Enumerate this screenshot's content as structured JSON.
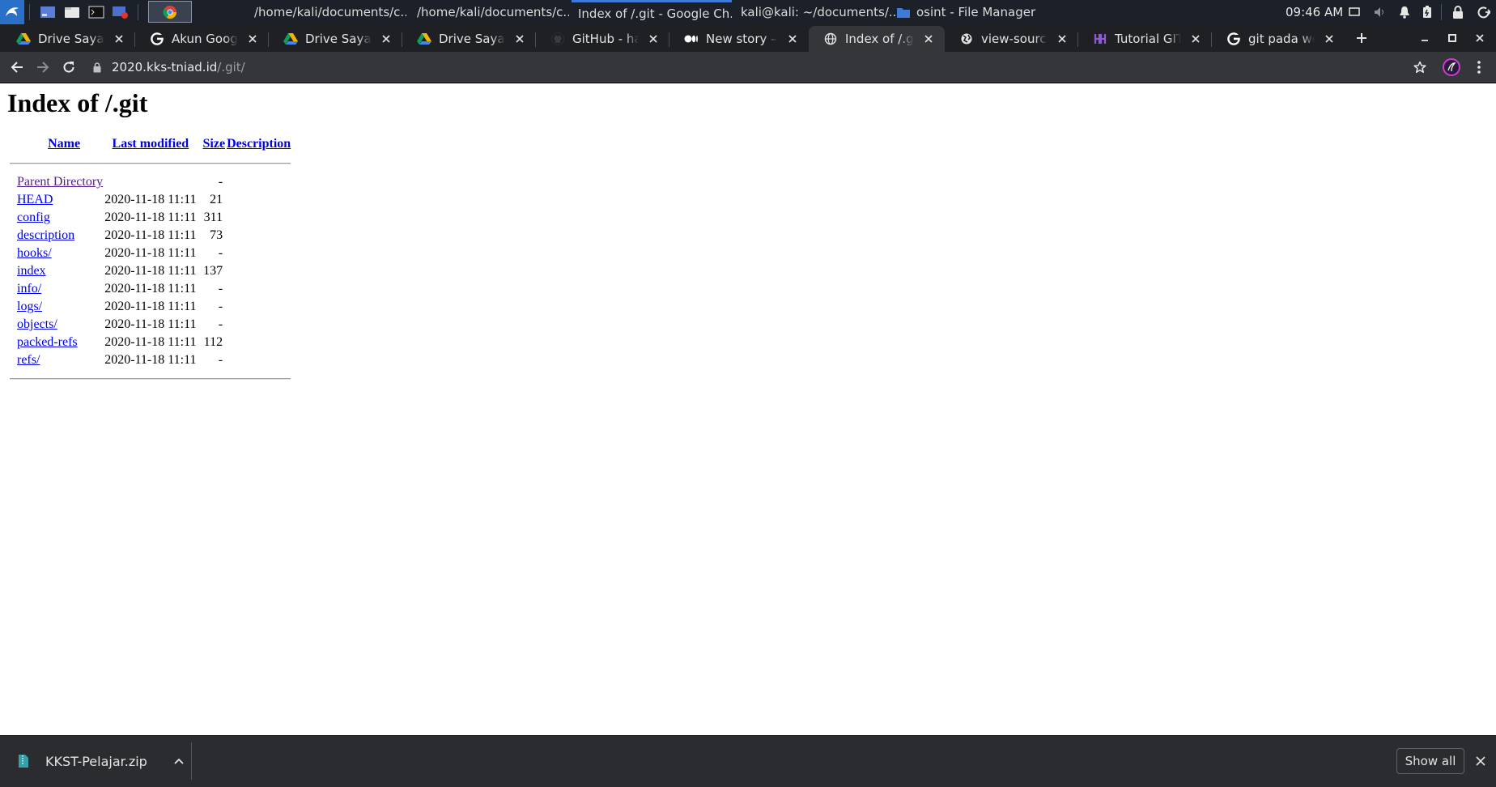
{
  "panel": {
    "window_tasks": [
      {
        "title": "/home/kali/documents/c...",
        "icon": "document-viewer-icon"
      },
      {
        "title": "/home/kali/documents/c...",
        "icon": "document-viewer-icon"
      },
      {
        "title": "Index of /.git - Google Ch...",
        "icon": "chrome-icon"
      },
      {
        "title": "kali@kali: ~/documents/...",
        "icon": "terminal-icon"
      },
      {
        "title": "osint - File Manager",
        "icon": "folder-icon"
      }
    ],
    "clock": "09:46 AM"
  },
  "browser": {
    "tabs": [
      {
        "title": "Drive Saya - Google Drive",
        "icon": "google-drive-icon"
      },
      {
        "title": "Akun Google",
        "icon": "google-icon"
      },
      {
        "title": "Drive Saya - Google Drive",
        "icon": "google-drive-icon"
      },
      {
        "title": "Drive Saya - Google Drive",
        "icon": "google-drive-icon"
      },
      {
        "title": "GitHub - hanas",
        "icon": "github-icon"
      },
      {
        "title": "New story – Medium",
        "icon": "medium-icon"
      },
      {
        "title": "Index of /.git",
        "icon": "globe-icon",
        "active": true
      },
      {
        "title": "view-source:https",
        "icon": "globe-icon"
      },
      {
        "title": "Tutorial GIT Dasar",
        "icon": "tutorial-site-icon"
      },
      {
        "title": "git pada website",
        "icon": "google-icon"
      }
    ],
    "address": {
      "host": "2020.kks-tniad.id",
      "path": "/.git/"
    }
  },
  "page": {
    "title": "Index of /.git",
    "columns": {
      "name": "Name",
      "modified": "Last modified",
      "size": "Size",
      "description": "Description"
    },
    "parent": {
      "name": "Parent Directory",
      "size": "-"
    },
    "entries": [
      {
        "name": "HEAD",
        "modified": "2020-11-18 11:11",
        "size": "21"
      },
      {
        "name": "config",
        "modified": "2020-11-18 11:11",
        "size": "311"
      },
      {
        "name": "description",
        "modified": "2020-11-18 11:11",
        "size": "73"
      },
      {
        "name": "hooks/",
        "modified": "2020-11-18 11:11",
        "size": "-"
      },
      {
        "name": "index",
        "modified": "2020-11-18 11:11",
        "size": "137"
      },
      {
        "name": "info/",
        "modified": "2020-11-18 11:11",
        "size": "-"
      },
      {
        "name": "logs/",
        "modified": "2020-11-18 11:11",
        "size": "-"
      },
      {
        "name": "objects/",
        "modified": "2020-11-18 11:11",
        "size": "-"
      },
      {
        "name": "packed-refs",
        "modified": "2020-11-18 11:11",
        "size": "112"
      },
      {
        "name": "refs/",
        "modified": "2020-11-18 11:11",
        "size": "-"
      }
    ]
  },
  "downloads": {
    "items": [
      {
        "filename": "KKST-Pelajar.zip",
        "icon": "zip-file-icon"
      }
    ],
    "show_all": "Show all"
  },
  "colors": {
    "link": "#0000ee",
    "visited_link": "#551a8b",
    "tab_strip": "#1f2024",
    "toolbar": "#35363a",
    "panel": "#1b2029",
    "active_indicator": "#3d7bd6"
  }
}
